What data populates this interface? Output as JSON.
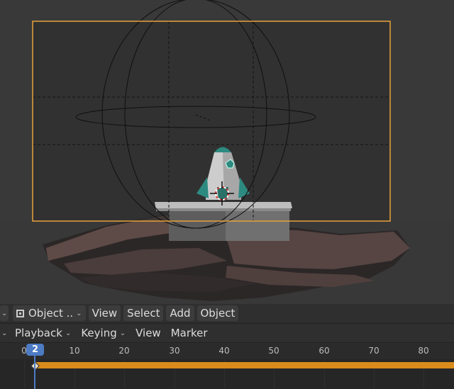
{
  "viewport_header": {
    "mode_label": "Object ..",
    "menus": [
      "View",
      "Select",
      "Add",
      "Object"
    ]
  },
  "timeline_header": {
    "playback_label": "Playback",
    "keying_label": "Keying",
    "menus": [
      "View",
      "Marker"
    ]
  },
  "timeline": {
    "ticks": [
      "0",
      "10",
      "20",
      "30",
      "40",
      "50",
      "60",
      "70",
      "80"
    ],
    "current_frame": "2"
  },
  "colors": {
    "accent": "#4d7bc4",
    "camera_frame": "#e8a23a",
    "keyframe_bar": "#d98c1c"
  },
  "icons": [
    "object-mode-icon",
    "chevron-down-icon",
    "keyframe-diamond-icon"
  ]
}
